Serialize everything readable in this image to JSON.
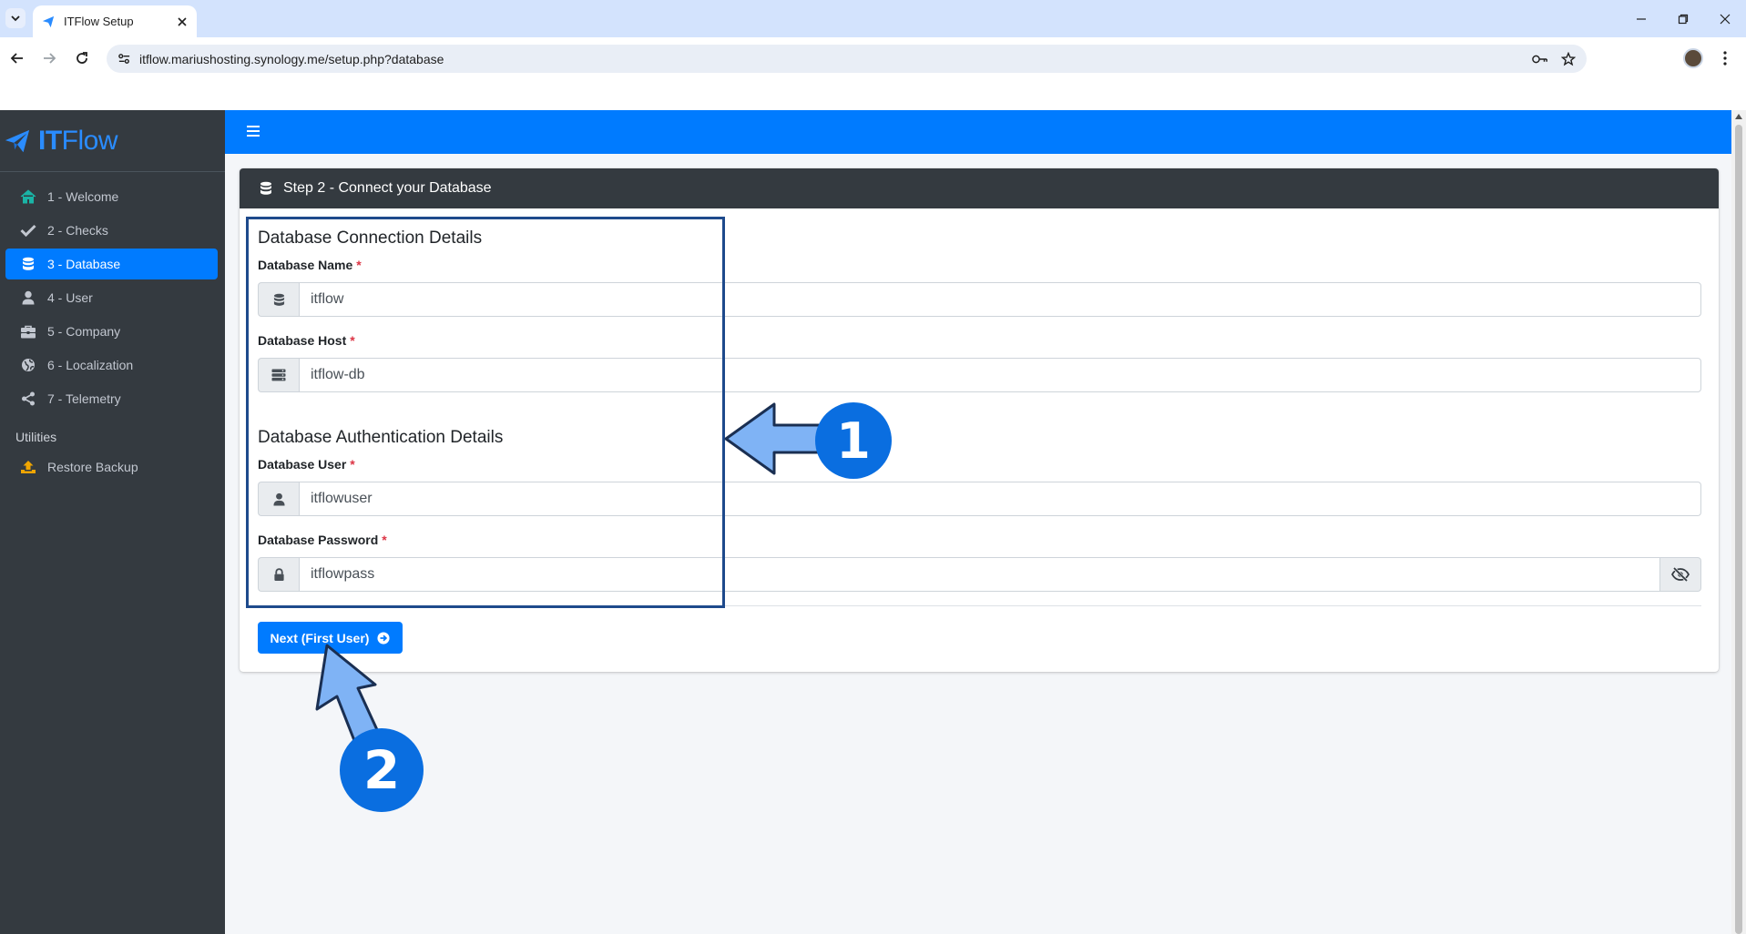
{
  "browser": {
    "tab_title": "ITFlow Setup",
    "url": "itflow.mariushosting.synology.me/setup.php?database"
  },
  "brand": {
    "part1": "IT",
    "part2": "Flow"
  },
  "sidebar": {
    "items": [
      {
        "label": "1 - Welcome",
        "icon": "home-icon"
      },
      {
        "label": "2 - Checks",
        "icon": "check-icon"
      },
      {
        "label": "3 - Database",
        "icon": "database-icon",
        "active": true
      },
      {
        "label": "4 - User",
        "icon": "user-icon"
      },
      {
        "label": "5 - Company",
        "icon": "briefcase-icon"
      },
      {
        "label": "6 - Localization",
        "icon": "globe-icon"
      },
      {
        "label": "7 - Telemetry",
        "icon": "share-icon"
      }
    ],
    "utilities_header": "Utilities",
    "utilities": [
      {
        "label": "Restore Backup",
        "icon": "upload-icon"
      }
    ]
  },
  "card": {
    "header": "Step 2 - Connect your Database",
    "connection_title": "Database Connection Details",
    "auth_title": "Database Authentication Details",
    "fields": {
      "name": {
        "label": "Database Name",
        "value": "itflow"
      },
      "host": {
        "label": "Database Host",
        "value": "itflow-db"
      },
      "user": {
        "label": "Database User",
        "value": "itflowuser"
      },
      "password": {
        "label": "Database Password",
        "value": "itflowpass"
      }
    },
    "required_mark": "*",
    "next_button": "Next (First User)"
  },
  "annotations": {
    "callout_1": "1",
    "callout_2": "2"
  },
  "colors": {
    "accent": "#007bff",
    "sidebar_bg": "#343a40",
    "callout": "#0a6ee0",
    "arrow_fill": "#7fb3f5",
    "highlight_border": "#1e4a8c"
  }
}
